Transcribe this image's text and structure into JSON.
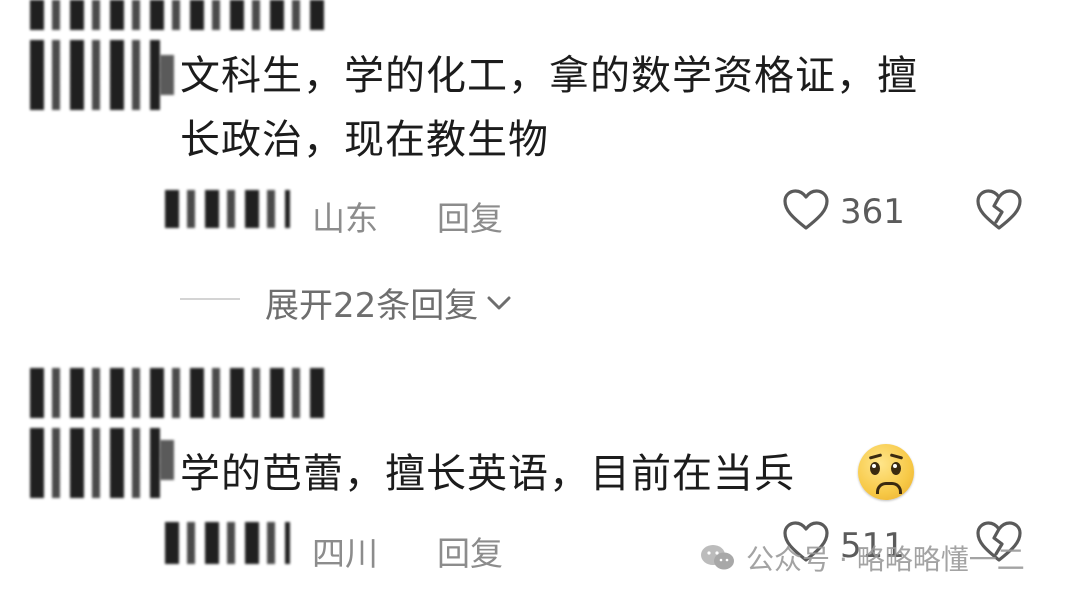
{
  "comments": [
    {
      "text_line1": "文科生，学的化工，拿的数学资格证，擅",
      "text_line2": "长政治，现在教生物",
      "location": "山东",
      "reply_label": "回复",
      "likes": "361",
      "expand_label": "展开22条回复"
    },
    {
      "text_line1": "学的芭蕾，擅长英语，目前在当兵",
      "location": "四川",
      "reply_label": "回复",
      "likes": "511"
    }
  ],
  "watermark": {
    "label": "公众号 · 略略略懂一二"
  },
  "icons": {
    "like": "heart-outline-icon",
    "dislike": "broken-heart-icon",
    "expand": "chevron-down-icon",
    "emoji": "pleading-face-emoji"
  }
}
